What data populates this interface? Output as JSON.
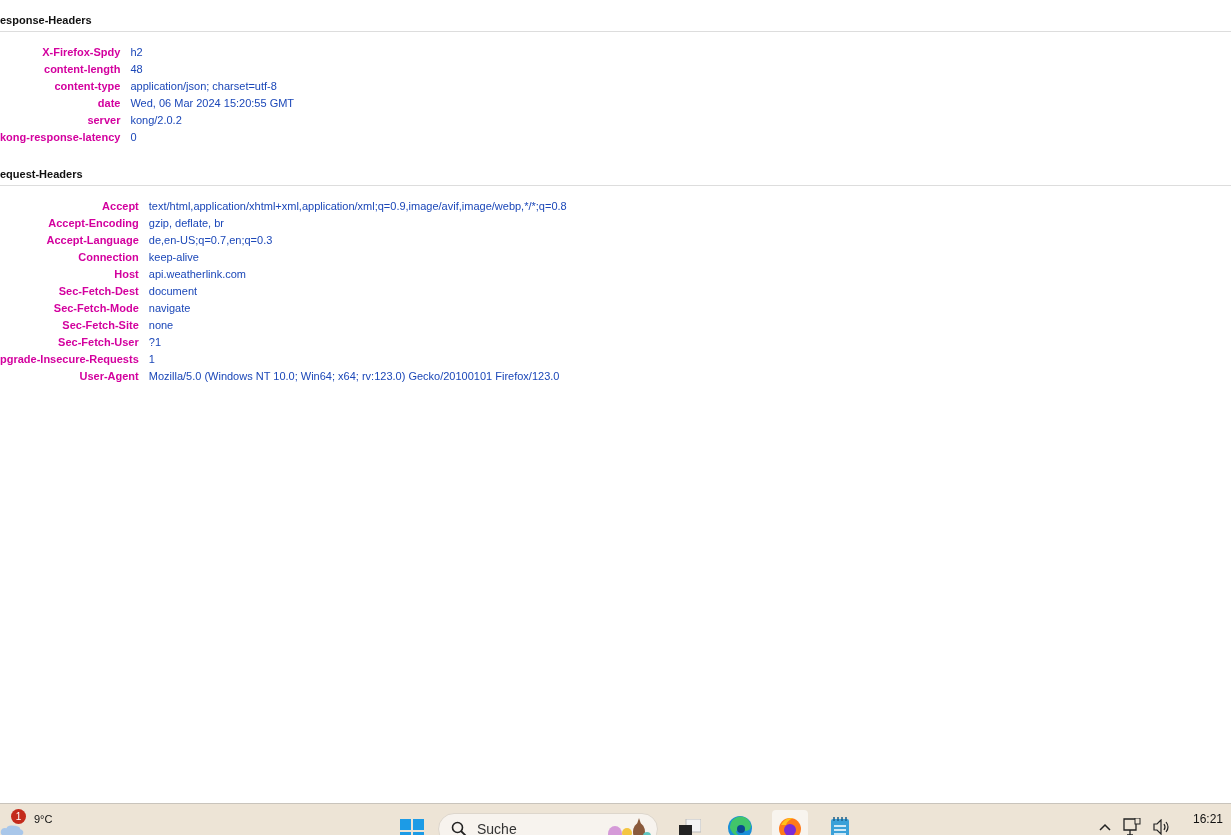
{
  "sections": [
    {
      "title": "esponse-Headers",
      "rows": [
        {
          "name": "X-Firefox-Spdy",
          "value": "h2"
        },
        {
          "name": "content-length",
          "value": "48"
        },
        {
          "name": "content-type",
          "value": "application/json; charset=utf-8"
        },
        {
          "name": "date",
          "value": "Wed, 06 Mar 2024 15:20:55 GMT"
        },
        {
          "name": "server",
          "value": "kong/2.0.2"
        },
        {
          "name": "kong-response-latency",
          "value": "0"
        }
      ]
    },
    {
      "title": "equest-Headers",
      "rows": [
        {
          "name": "Accept",
          "value": "text/html,application/xhtml+xml,application/xml;q=0.9,image/avif,image/webp,*/*;q=0.8"
        },
        {
          "name": "Accept-Encoding",
          "value": "gzip, deflate, br"
        },
        {
          "name": "Accept-Language",
          "value": "de,en-US;q=0.7,en;q=0.3"
        },
        {
          "name": "Connection",
          "value": "keep-alive"
        },
        {
          "name": "Host",
          "value": "api.weatherlink.com"
        },
        {
          "name": "Sec-Fetch-Dest",
          "value": "document"
        },
        {
          "name": "Sec-Fetch-Mode",
          "value": "navigate"
        },
        {
          "name": "Sec-Fetch-Site",
          "value": "none"
        },
        {
          "name": "Sec-Fetch-User",
          "value": "?1"
        },
        {
          "name": "pgrade-Insecure-Requests",
          "value": "1"
        },
        {
          "name": "User-Agent",
          "value": "Mozilla/5.0 (Windows NT 10.0; Win64; x64; rv:123.0) Gecko/20100101 Firefox/123.0"
        }
      ]
    }
  ],
  "taskbar": {
    "weather": {
      "badge": "1",
      "temperature": "9°C"
    },
    "search": {
      "placeholder": "Suche"
    },
    "apps": [
      {
        "kind": "taskview",
        "selected": false
      },
      {
        "kind": "edge",
        "selected": false
      },
      {
        "kind": "firefox",
        "selected": true
      },
      {
        "kind": "notepad",
        "selected": false
      }
    ],
    "clock": {
      "time": "16:21"
    }
  }
}
